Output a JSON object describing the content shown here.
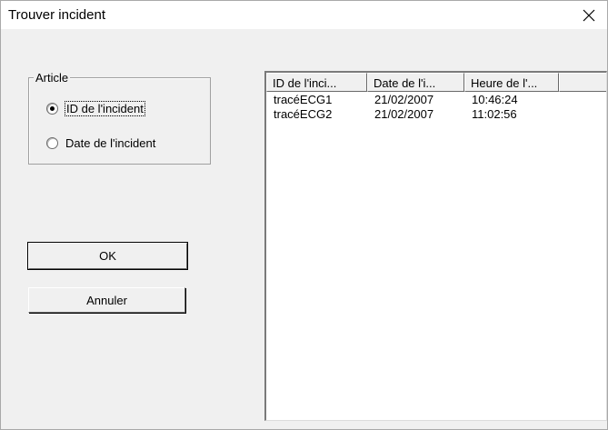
{
  "window": {
    "title": "Trouver incident"
  },
  "group": {
    "legend": "Article",
    "options": [
      {
        "label": "ID de l'incident",
        "selected": true
      },
      {
        "label": "Date de l'incident",
        "selected": false
      }
    ]
  },
  "buttons": {
    "ok": "OK",
    "cancel": "Annuler"
  },
  "list": {
    "columns": [
      "ID de l'inci...",
      "Date de l'i...",
      "Heure de l'..."
    ],
    "rows": [
      [
        "tracéECG1",
        "21/02/2007",
        "10:46:24"
      ],
      [
        "tracéECG2",
        "21/02/2007",
        "11:02:56"
      ]
    ]
  }
}
